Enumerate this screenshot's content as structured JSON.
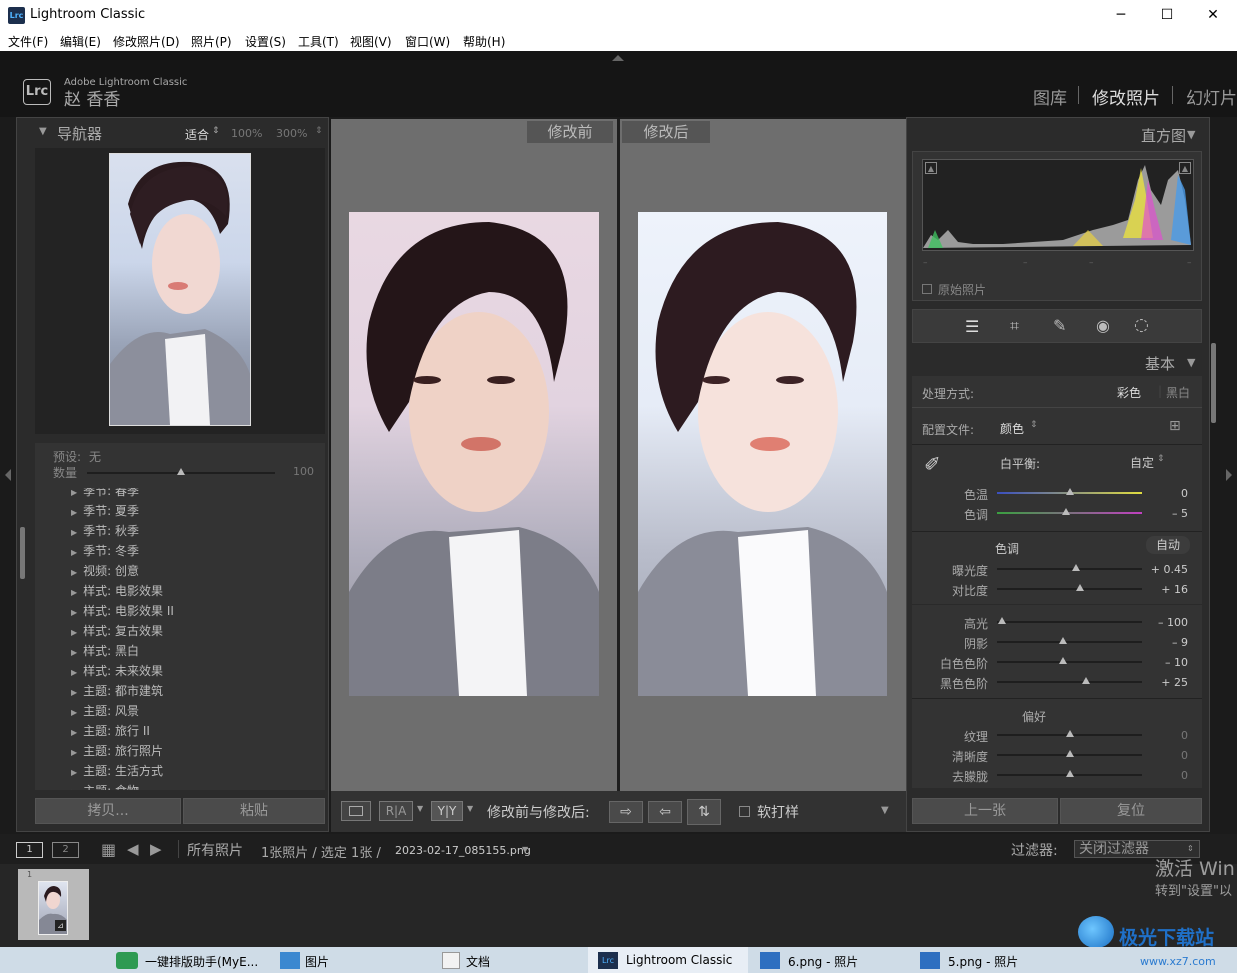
{
  "window": {
    "title": "Lightroom Classic",
    "icon": "Lrc",
    "min": "─",
    "max": "☐",
    "close": "✕"
  },
  "menu": [
    "文件(F)",
    "编辑(E)",
    "修改照片(D)",
    "照片(P)",
    "设置(S)",
    "工具(T)",
    "视图(V)",
    "窗口(W)",
    "帮助(H)"
  ],
  "identity": {
    "logo": "Lrc",
    "brand": "Adobe Lightroom Classic",
    "user": "赵 香香"
  },
  "modules": [
    "图库",
    "修改照片",
    "幻灯片"
  ],
  "navigator": {
    "title": "导航器",
    "fit": "适合",
    "zoom1": "100%",
    "zoom2": "300%"
  },
  "presets": {
    "label": "预设:",
    "value": "无",
    "amount_label": "数量",
    "amount_value": "100",
    "amount_level": 0.5,
    "items": [
      "季节: 春季",
      "季节: 夏季",
      "季节: 秋季",
      "季节: 冬季",
      "视频: 创意",
      "样式: 电影效果",
      "样式: 电影效果 II",
      "样式: 复古效果",
      "样式: 黑白",
      "样式: 未来效果",
      "主题: 都市建筑",
      "主题: 风景",
      "主题: 旅行 II",
      "主题: 旅行照片",
      "主题: 生活方式",
      "主题: 食物"
    ]
  },
  "left_buttons": {
    "copy": "拷贝...",
    "paste": "粘贴"
  },
  "compare": {
    "before": "修改前",
    "after": "修改后"
  },
  "toolbar": {
    "label": "修改前与修改后:",
    "softproof": "软打样",
    "ra": "R|A",
    "yy": "Y|Y"
  },
  "right_buttons": {
    "prev": "上一张",
    "reset": "复位"
  },
  "histogram": {
    "title": "直方图",
    "original": "原始照片",
    "ticks": [
      "–",
      "–",
      "–",
      "–"
    ]
  },
  "basic": {
    "title": "基本",
    "treatment": "处理方式:",
    "color": "彩色",
    "bw": "黑白",
    "profile_label": "配置文件:",
    "profile": "颜色",
    "wb_label": "白平衡:",
    "wb_value": "自定",
    "wb_sliders": [
      {
        "name": "色温",
        "value": "0",
        "level": 0.5
      },
      {
        "name": "色调",
        "value": "– 5",
        "level": 0.47
      }
    ],
    "tone_title": "色调",
    "auto": "自动",
    "tone_sliders": [
      {
        "name": "曝光度",
        "value": "+ 0.45",
        "level": 0.55
      },
      {
        "name": "对比度",
        "value": "+ 16",
        "level": 0.58
      }
    ],
    "tone2_sliders": [
      {
        "name": "高光",
        "value": "– 100",
        "level": 0.0
      },
      {
        "name": "阴影",
        "value": "– 9",
        "level": 0.45
      },
      {
        "name": "白色色阶",
        "value": "– 10",
        "level": 0.45
      },
      {
        "name": "黑色色阶",
        "value": "+ 25",
        "level": 0.62
      }
    ],
    "presence_title": "偏好",
    "presence_sliders": [
      {
        "name": "纹理",
        "value": "0",
        "level": 0.5
      },
      {
        "name": "清晰度",
        "value": "0",
        "level": 0.5
      },
      {
        "name": "去朦胧",
        "value": "0",
        "level": 0.5
      }
    ]
  },
  "filmstrip": {
    "view1": "1",
    "view2": "2",
    "source": "所有照片",
    "count": "1张照片 / 选定 1张 /",
    "filename": "2023-02-17_085155.png",
    "filter_label": "过滤器:",
    "filter_value": "关闭过滤器",
    "thumb_index": "1"
  },
  "watermark": {
    "line1": "激活 Win",
    "line2": "转到\"设置\"以",
    "site": "极光下载站",
    "url": "www.xz7.com"
  },
  "taskbar": [
    "一键排版助手(MyE...",
    "图片",
    "文档",
    "Lightroom Classic",
    "6.png - 照片",
    "5.png - 照片"
  ]
}
